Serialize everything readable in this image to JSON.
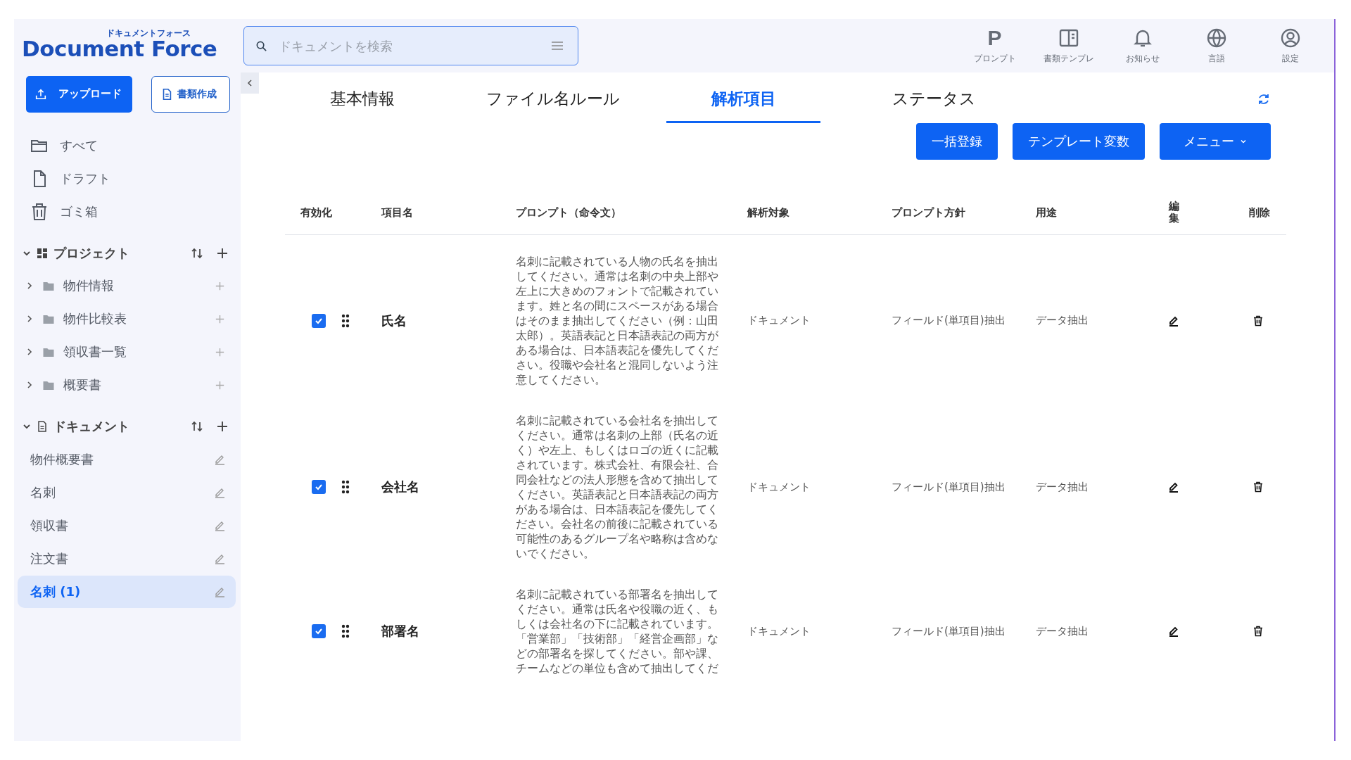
{
  "brand": {
    "kana": "ドキュメントフォース",
    "name": "Document Force"
  },
  "sidebar": {
    "upload_button": "アップロード",
    "create_button": "書類作成",
    "nav": [
      {
        "label": "すべて",
        "kind": "folder"
      },
      {
        "label": "ドラフト",
        "kind": "file"
      },
      {
        "label": "ゴミ箱",
        "kind": "trash"
      }
    ],
    "sections": [
      {
        "title": "プロジェクト",
        "kind": "project",
        "expanded": true,
        "items": [
          {
            "label": "物件情報",
            "expanded": false
          },
          {
            "label": "物件比較表",
            "expanded": false
          },
          {
            "label": "領収書一覧",
            "expanded": false
          },
          {
            "label": "概要書",
            "expanded": false
          }
        ]
      },
      {
        "title": "ドキュメント",
        "kind": "document",
        "expanded": true,
        "items": [
          {
            "label": "物件概要書",
            "selected": false
          },
          {
            "label": "名刺",
            "selected": false
          },
          {
            "label": "領収書",
            "selected": false
          },
          {
            "label": "注文書",
            "selected": false
          },
          {
            "label": "名刺 (1)",
            "selected": true
          }
        ]
      }
    ]
  },
  "search": {
    "placeholder": "ドキュメントを検索"
  },
  "top_actions": [
    {
      "label": "プロンプト",
      "kind": "letter",
      "glyph": "P"
    },
    {
      "label": "書類テンプレ",
      "kind": "template"
    },
    {
      "label": "お知らせ",
      "kind": "bell"
    },
    {
      "label": "言語",
      "kind": "globe"
    },
    {
      "label": "設定",
      "kind": "user"
    }
  ],
  "tabs": [
    {
      "label": "基本情報",
      "selected": false
    },
    {
      "label": "ファイル名ルール",
      "selected": false
    },
    {
      "label": "解析項目",
      "selected": true
    },
    {
      "label": "ステータス",
      "selected": false
    }
  ],
  "actions": [
    {
      "label": "一括登録",
      "dropdown": false
    },
    {
      "label": "テンプレート変数",
      "dropdown": false
    },
    {
      "label": "メニュー",
      "dropdown": true
    }
  ],
  "table": {
    "columns": [
      "有効化",
      "項目名",
      "プロンプト（命令文）",
      "解析対象",
      "プロンプト方針",
      "用途",
      "編集",
      "削除"
    ],
    "rows": [
      {
        "enabled": true,
        "name": "氏名",
        "prompt": "名刺に記載されている人物の氏名を抽出してください。通常は名刺の中央上部や左上に大きめのフォントで記載されています。姓と名の間にスペースがある場合はそのまま抽出してください（例：山田太郎）。英語表記と日本語表記の両方がある場合は、日本語表記を優先してください。役職や会社名と混同しないよう注意してください。",
        "target": "ドキュメント",
        "policy": "フィールド(単項目)抽出",
        "purpose": "データ抽出"
      },
      {
        "enabled": true,
        "name": "会社名",
        "prompt": "名刺に記載されている会社名を抽出してください。通常は名刺の上部（氏名の近く）や左上、もしくはロゴの近くに記載されています。株式会社、有限会社、合同会社などの法人形態を含めて抽出してください。英語表記と日本語表記の両方がある場合は、日本語表記を優先してください。会社名の前後に記載されている可能性のあるグループ名や略称は含めないでください。",
        "target": "ドキュメント",
        "policy": "フィールド(単項目)抽出",
        "purpose": "データ抽出"
      },
      {
        "enabled": true,
        "name": "部署名",
        "prompt": "名刺に記載されている部署名を抽出してください。通常は氏名や役職の近く、もしくは会社名の下に記載されています。「営業部」「技術部」「経営企画部」などの部署名を探してください。部や課、チームなどの単位も含めて抽出してくだ",
        "target": "ドキュメント",
        "policy": "フィールド(単項目)抽出",
        "purpose": "データ抽出"
      }
    ]
  }
}
